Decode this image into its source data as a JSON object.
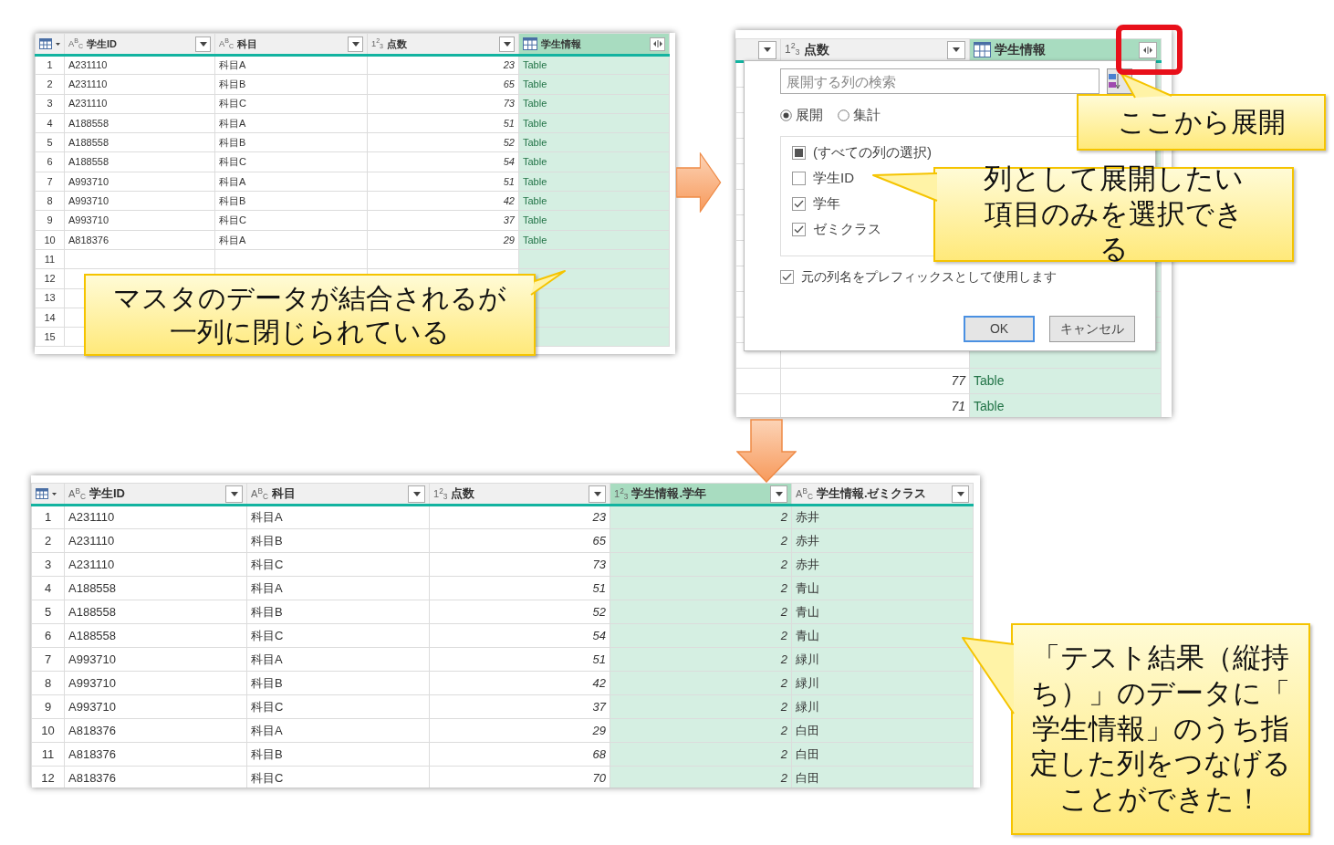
{
  "source_table": {
    "columns": [
      {
        "name": "学生ID",
        "kind": "text",
        "type_icon": "A$^{B}$$_{C}$",
        "selected": false,
        "highlighted": false
      },
      {
        "name": "科目",
        "kind": "text",
        "type_icon": "A$^{B}$$_{C}$",
        "selected": false,
        "highlighted": false
      },
      {
        "name": "点数",
        "kind": "number",
        "type_icon": "1$^{2}$$_{3}$",
        "selected": false,
        "highlighted": false
      },
      {
        "name": "学生情報",
        "kind": "table",
        "selected": true,
        "highlighted": true
      }
    ],
    "rows": [
      {
        "number": "1",
        "cells": [
          "A231110",
          "科目A",
          "23",
          "Table"
        ]
      },
      {
        "number": "2",
        "cells": [
          "A231110",
          "科目B",
          "65",
          "Table"
        ]
      },
      {
        "number": "3",
        "cells": [
          "A231110",
          "科目C",
          "73",
          "Table"
        ]
      },
      {
        "number": "4",
        "cells": [
          "A188558",
          "科目A",
          "51",
          "Table"
        ]
      },
      {
        "number": "5",
        "cells": [
          "A188558",
          "科目B",
          "52",
          "Table"
        ]
      },
      {
        "number": "6",
        "cells": [
          "A188558",
          "科目C",
          "54",
          "Table"
        ]
      },
      {
        "number": "7",
        "cells": [
          "A993710",
          "科目A",
          "51",
          "Table"
        ]
      },
      {
        "number": "8",
        "cells": [
          "A993710",
          "科目B",
          "42",
          "Table"
        ]
      },
      {
        "number": "9",
        "cells": [
          "A993710",
          "科目C",
          "37",
          "Table"
        ]
      },
      {
        "number": "10",
        "cells": [
          "A818376",
          "科目A",
          "29",
          "Table"
        ]
      },
      {
        "number": "11"
      },
      {
        "number": "12"
      },
      {
        "number": "13"
      },
      {
        "number": "14"
      },
      {
        "number": "15"
      }
    ]
  },
  "expand_view": {
    "table": {
      "columns": [
        {
          "kind": "cut",
          "selected": false,
          "highlighted": false
        },
        {
          "name": "点数",
          "kind": "number",
          "type_icon": "1$^{2}$$_{3}$",
          "selected": false,
          "highlighted": false
        },
        {
          "name": "学生情報",
          "kind": "table",
          "selected": true,
          "highlighted": true
        }
      ],
      "rows": [
        {
          "cells": [
            "",
            "77",
            "Table"
          ]
        },
        {
          "cells": [
            "",
            "71",
            "Table"
          ]
        }
      ]
    },
    "dialog": {
      "search": {
        "placeholder": "展開する列の検索"
      },
      "modes": [
        {
          "label": "展開",
          "selected": true
        },
        {
          "label": "集計",
          "selected": false
        }
      ],
      "column_options": [
        {
          "label": "(すべての列の選択)",
          "kind": "select_all",
          "indeterminate": true
        },
        {
          "label": "学生ID",
          "kind": "column",
          "checked": false
        },
        {
          "label": "学年",
          "kind": "column",
          "checked": true
        },
        {
          "label": "ゼミクラス",
          "kind": "column",
          "checked": true
        }
      ],
      "prefix_option": {
        "label": "元の列名をプレフィックスとして使用します",
        "checked": true
      },
      "buttons": [
        {
          "label": "OK",
          "default": true
        },
        {
          "label": "キャンセル",
          "default": false
        }
      ]
    }
  },
  "result_table": {
    "columns": [
      {
        "name": "学生ID",
        "kind": "text",
        "type_icon": "A$^{B}$$_{C}$",
        "selected": false,
        "highlighted": false
      },
      {
        "name": "科目",
        "kind": "text",
        "type_icon": "A$^{B}$$_{C}$",
        "selected": false,
        "highlighted": false
      },
      {
        "name": "点数",
        "kind": "number",
        "type_icon": "1$^{2}$$_{3}$",
        "selected": false,
        "highlighted": false
      },
      {
        "name": "学生情報.学年",
        "kind": "number",
        "type_icon": "1$^{2}$$_{3}$",
        "selected": true,
        "highlighted": true
      },
      {
        "name": "学生情報.ゼミクラス",
        "kind": "text",
        "type_icon": "A$^{B}$$_{C}$",
        "selected": false,
        "highlighted": true
      }
    ],
    "rows": [
      {
        "number": "1",
        "cells": [
          "A231110",
          "科目A",
          "23",
          "2",
          "赤井"
        ]
      },
      {
        "number": "2",
        "cells": [
          "A231110",
          "科目B",
          "65",
          "2",
          "赤井"
        ]
      },
      {
        "number": "3",
        "cells": [
          "A231110",
          "科目C",
          "73",
          "2",
          "赤井"
        ]
      },
      {
        "number": "4",
        "cells": [
          "A188558",
          "科目A",
          "51",
          "2",
          "青山"
        ]
      },
      {
        "number": "5",
        "cells": [
          "A188558",
          "科目B",
          "52",
          "2",
          "青山"
        ]
      },
      {
        "number": "6",
        "cells": [
          "A188558",
          "科目C",
          "54",
          "2",
          "青山"
        ]
      },
      {
        "number": "7",
        "cells": [
          "A993710",
          "科目A",
          "51",
          "2",
          "緑川"
        ]
      },
      {
        "number": "8",
        "cells": [
          "A993710",
          "科目B",
          "42",
          "2",
          "緑川"
        ]
      },
      {
        "number": "9",
        "cells": [
          "A993710",
          "科目C",
          "37",
          "2",
          "緑川"
        ]
      },
      {
        "number": "10",
        "cells": [
          "A818376",
          "科目A",
          "29",
          "2",
          "白田"
        ]
      },
      {
        "number": "11",
        "cells": [
          "A818376",
          "科目B",
          "68",
          "2",
          "白田"
        ]
      },
      {
        "number": "12",
        "cells": [
          "A818376",
          "科目C",
          "70",
          "2",
          "白田"
        ]
      }
    ]
  },
  "callouts": [
    {
      "text": "マスタのデータが結合されるが一列に閉じられている"
    },
    {
      "text": "ここから展開"
    },
    {
      "text": "列として展開したい項目のみを選択できる"
    },
    {
      "text": "「テスト結果（縦持ち）」のデータに「学生情報」のうち指定した列をつなげることができた！"
    }
  ]
}
